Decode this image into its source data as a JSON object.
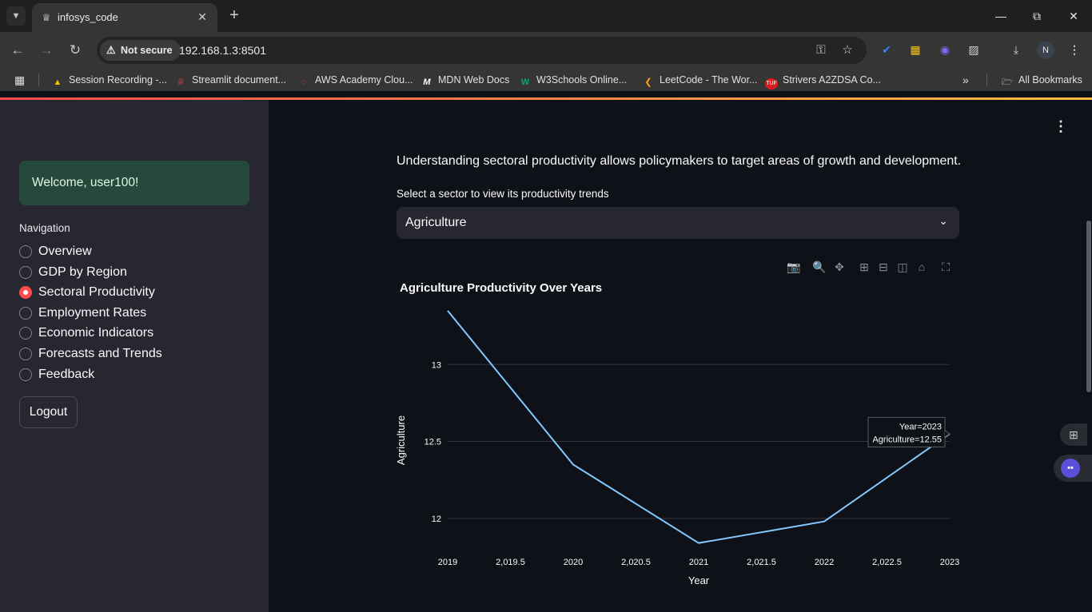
{
  "browser": {
    "tab_title": "infosys_code",
    "security_label": "Not secure",
    "url": "192.168.1.3:8501",
    "profile_initial": "N",
    "bookmarks": [
      {
        "label": "Session Recording -...",
        "icon": "google-drive-icon",
        "color": "#fbbc04"
      },
      {
        "label": "Streamlit document...",
        "icon": "streamlit-icon",
        "color": "#ff4b4b"
      },
      {
        "label": "AWS Academy Clou...",
        "icon": "aws-icon",
        "color": "#e4463a"
      },
      {
        "label": "MDN Web Docs",
        "icon": "mdn-icon",
        "color": "#ffffff"
      },
      {
        "label": "W3Schools Online...",
        "icon": "w3schools-icon",
        "color": "#04aa6d"
      },
      {
        "label": "LeetCode - The Wor...",
        "icon": "leetcode-icon",
        "color": "#ffa116"
      },
      {
        "label": "Strivers A2ZDSA Co...",
        "icon": "tuf-icon",
        "color": "#d91c1c"
      }
    ],
    "all_bookmarks_label": "All Bookmarks"
  },
  "sidebar": {
    "welcome": "Welcome, user100!",
    "nav_label": "Navigation",
    "items": [
      {
        "label": "Overview",
        "checked": false
      },
      {
        "label": "GDP by Region",
        "checked": false
      },
      {
        "label": "Sectoral Productivity",
        "checked": true
      },
      {
        "label": "Employment Rates",
        "checked": false
      },
      {
        "label": "Economic Indicators",
        "checked": false
      },
      {
        "label": "Forecasts and Trends",
        "checked": false
      },
      {
        "label": "Feedback",
        "checked": false
      }
    ],
    "logout_label": "Logout"
  },
  "main": {
    "intro": "Understanding sectoral productivity allows policymakers to target areas of growth and development.",
    "select_label": "Select a sector to view its productivity trends",
    "selected_sector": "Agriculture"
  },
  "chart_data": {
    "type": "line",
    "title": "Agriculture Productivity Over Years",
    "xlabel": "Year",
    "ylabel": "Agriculture",
    "x": [
      2019,
      2020,
      2021,
      2022,
      2023
    ],
    "series": [
      {
        "values": [
          13.35,
          12.35,
          11.84,
          11.98,
          12.55
        ]
      }
    ],
    "xlim": [
      2019,
      2023
    ],
    "ylim": [
      11.75,
      13.37
    ],
    "x_ticks": [
      "2019",
      "2,019.5",
      "2020",
      "2,020.5",
      "2021",
      "2,021.5",
      "2022",
      "2,022.5",
      "2023"
    ],
    "y_ticks": [
      "12",
      "12.5",
      "13"
    ],
    "grid": true,
    "line_color": "#83c9ff",
    "hover": {
      "year_text": "Year=2023",
      "value_text": "Agriculture=12.55"
    }
  }
}
